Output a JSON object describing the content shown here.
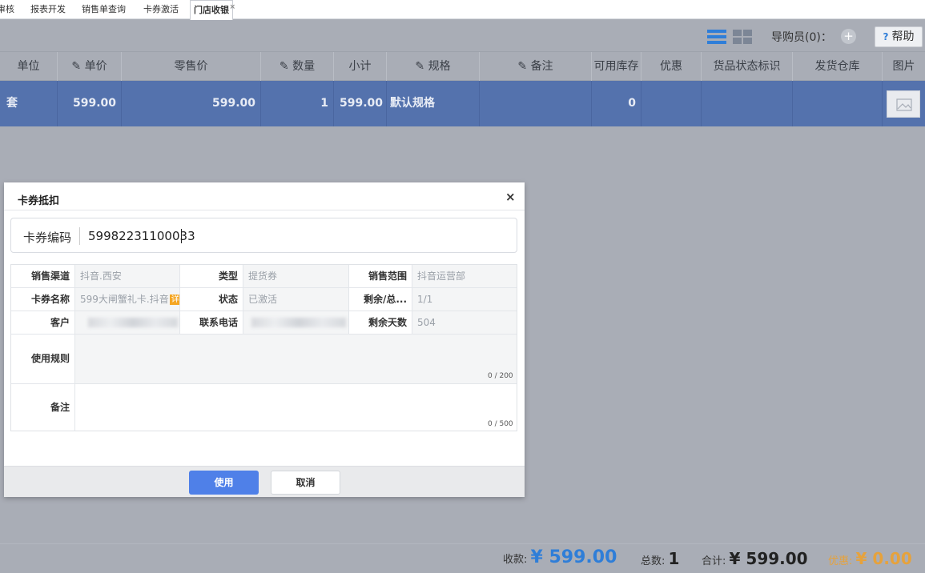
{
  "tabs": [
    {
      "label": "审核"
    },
    {
      "label": "报表开发"
    },
    {
      "label": "销售单查询"
    },
    {
      "label": "卡券激活"
    },
    {
      "label": "门店收银",
      "close": "×"
    }
  ],
  "toolbar": {
    "guide_label": "导购员(0)：",
    "guide_add": "+",
    "help_q": "?",
    "help_label": "帮助"
  },
  "table": {
    "headers": {
      "unit": "单位",
      "unit_price": "✎ 单价",
      "retail_price": "零售价",
      "quantity": "✎ 数量",
      "subtotal": "小计",
      "spec": "✎ 规格",
      "remark": "✎ 备注",
      "stock": "可用库存",
      "discount": "优惠",
      "status_tag": "货品状态标识",
      "warehouse": "发货仓库",
      "image": "图片"
    },
    "row": {
      "unit": "套",
      "unit_price": "599.00",
      "retail_price": "599.00",
      "quantity": "1",
      "subtotal": "599.00",
      "spec": "默认规格",
      "remark": "",
      "stock": "0",
      "discount": "",
      "status_tag": "",
      "warehouse": ""
    }
  },
  "modal": {
    "title": "卡券抵扣",
    "close": "×",
    "code_label": "卡券编码",
    "code_value": "59982231100033",
    "fields": {
      "channel_label": "销售渠道",
      "channel_value": "抖音.西安",
      "type_label": "类型",
      "type_value": "提货券",
      "scope_label": "销售范围",
      "scope_value": "抖音运营部",
      "name_label": "卡券名称",
      "name_value": "599大闸蟹礼卡.抖音",
      "detail_tag": "详",
      "state_label": "状态",
      "state_value": "已激活",
      "remain_total_label": "剩余/总...",
      "remain_total_value": "1/1",
      "customer_label": "客户",
      "phone_label": "联系电话",
      "remain_days_label": "剩余天数",
      "remain_days_value": "504",
      "rules_label": "使用规则",
      "rules_counter": "0 / 200",
      "note_label": "备注",
      "note_counter": "0 / 500"
    },
    "use_button": "使用",
    "cancel_button": "取消"
  },
  "totals": {
    "received_label": "收款:",
    "received_value": "¥ 599.00",
    "count_label": "总数:",
    "count_value": "1",
    "sum_label": "合计:",
    "sum_value": "¥ 599.00",
    "discount_label": "优惠:",
    "discount_value": "¥ 0.00"
  }
}
